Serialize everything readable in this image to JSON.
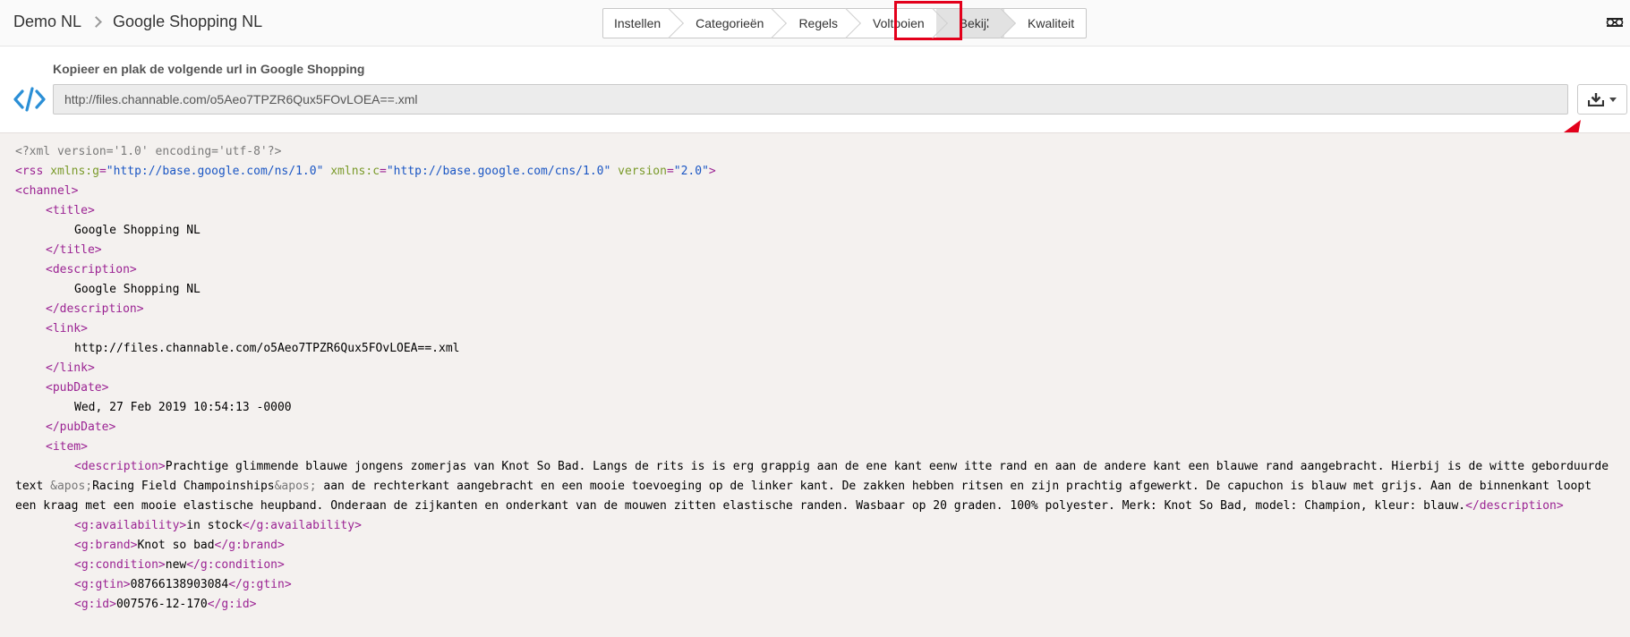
{
  "header": {
    "breadcrumb": [
      "Demo NL",
      "Google Shopping NL"
    ],
    "steps": [
      "Instellen",
      "Categorieën",
      "Regels",
      "Voltooien",
      "Bekijk",
      "Kwaliteit"
    ],
    "active_step": "Bekijk"
  },
  "url_section": {
    "label": "Kopieer en plak de volgende url in Google Shopping",
    "url": "http://files.channable.com/o5Aeo7TPZR6Qux5FOvLOEA==.xml"
  },
  "xml": {
    "declaration": "<?xml version='1.0' encoding='utf-8'?>",
    "rss_open": "<rss",
    "attr_g": "xmlns:g",
    "val_g": "\"http://base.google.com/ns/1.0\"",
    "attr_c": "xmlns:c",
    "val_c": "\"http://base.google.com/cns/1.0\"",
    "attr_v": "version",
    "val_v": "\"2.0\"",
    "channel_open": "<channel>",
    "title_open": "<title>",
    "title_value": "Google Shopping NL",
    "title_close": "</title>",
    "desc_open": "<description>",
    "desc_value": "Google Shopping NL",
    "desc_close": "</description>",
    "link_open": "<link>",
    "link_value": "http://files.channable.com/o5Aeo7TPZR6Qux5FOvLOEA==.xml",
    "link_close": "</link>",
    "pub_open": "<pubDate>",
    "pub_value": "Wed, 27 Feb 2019 10:54:13 -0000",
    "pub_close": "</pubDate>",
    "item_open": "<item>",
    "item_desc_part1": "Prachtige glimmende blauwe jongens zomerjas van Knot So Bad. Langs de rits is is erg grappig aan de ene kant eenw itte rand en aan de andere kant een blauwe rand aangebracht. Hierbij is de witte geborduurde text ",
    "entity": "&apos;",
    "item_desc_part2": "Racing Field Champoinships",
    "item_desc_part3": " aan de rechterkant aangebracht en een mooie toevoeging op de linker kant. De zakken hebben ritsen en zijn prachtig afgewerkt. De capuchon is blauw met grijs. Aan de binnenkant loopt een kraag met een mooie elastische heupband. Onderaan de zijkanten en onderkant van de mouwen zitten elastische randen. Wasbaar op 20 graden. 100% polyester. Merk: Knot So Bad, model: Champion, kleur: blauw.",
    "fields": [
      {
        "open": "<g:availability>",
        "value": "in stock",
        "close": "</g:availability>"
      },
      {
        "open": "<g:brand>",
        "value": "Knot so bad",
        "close": "</g:brand>"
      },
      {
        "open": "<g:condition>",
        "value": "new",
        "close": "</g:condition>"
      },
      {
        "open": "<g:gtin>",
        "value": "08766138903084",
        "close": "</g:gtin>"
      },
      {
        "open": "<g:id>",
        "value": "007576-12-170",
        "close": "</g:id>"
      }
    ]
  },
  "colors": {
    "highlight": "#e3001b",
    "code_icon": "#2b8fd6",
    "xml_tag": "#9b2393",
    "xml_attr": "#7a9a2a",
    "xml_value": "#1a56c4"
  }
}
